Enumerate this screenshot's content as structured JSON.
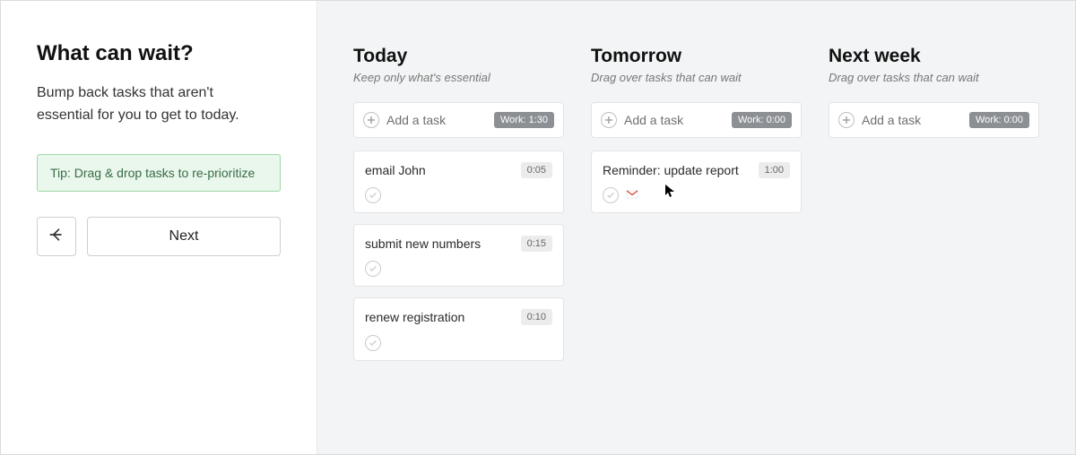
{
  "left": {
    "title": "What can wait?",
    "subtitle": "Bump back tasks that aren't essential for you to get to today.",
    "tip": "Tip: Drag & drop tasks to re-prioritize",
    "next_label": "Next"
  },
  "columns": [
    {
      "heading": "Today",
      "sub": "Keep only what's essential",
      "add_label": "Add a task",
      "work_badge": "Work: 1:30",
      "tasks": [
        {
          "title": "email John",
          "duration": "0:05",
          "hasGmail": false
        },
        {
          "title": "submit new numbers",
          "duration": "0:15",
          "hasGmail": false
        },
        {
          "title": "renew registration",
          "duration": "0:10",
          "hasGmail": false
        }
      ]
    },
    {
      "heading": "Tomorrow",
      "sub": "Drag over tasks that can wait",
      "add_label": "Add a task",
      "work_badge": "Work: 0:00",
      "tasks": [
        {
          "title": "Reminder: update report",
          "duration": "1:00",
          "hasGmail": true
        }
      ]
    },
    {
      "heading": "Next week",
      "sub": "Drag over tasks that can wait",
      "add_label": "Add a task",
      "work_badge": "Work: 0:00",
      "tasks": []
    }
  ]
}
